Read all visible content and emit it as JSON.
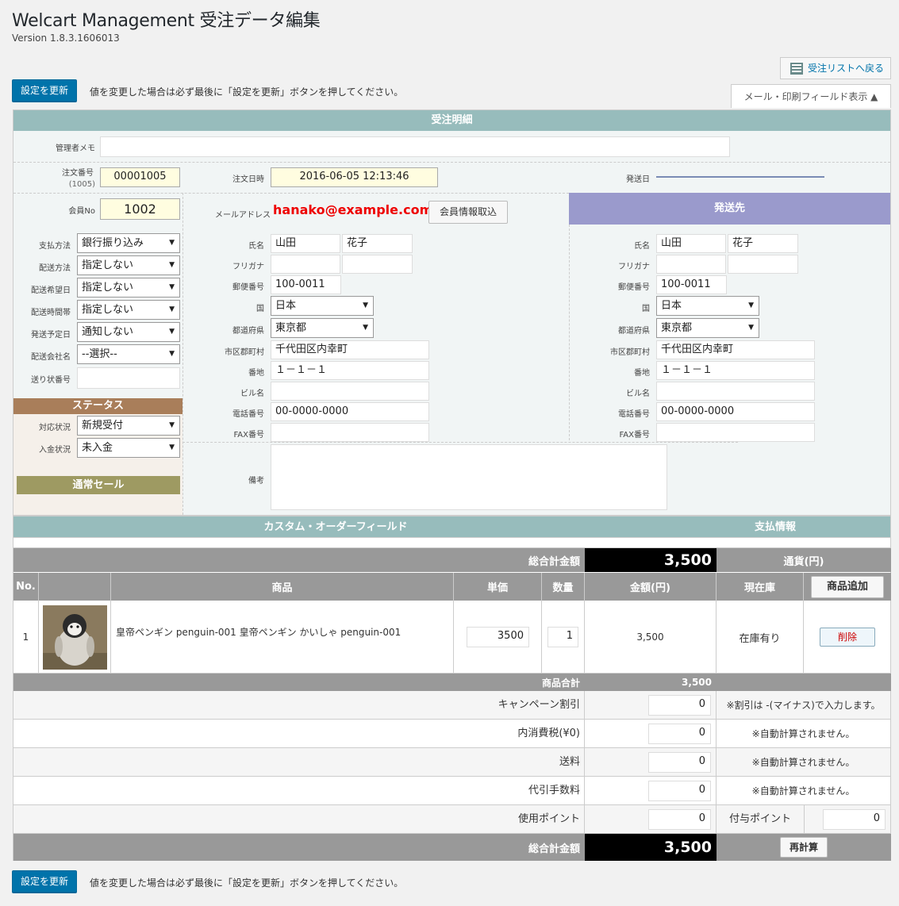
{
  "header": {
    "title": "Welcart Management 受注データ編集",
    "version": "Version 1.8.3.1606013",
    "back_label": "受注リストへ戻る",
    "mail_toggle": "メール・印刷フィールド表示 ▲"
  },
  "actions": {
    "update_label": "設定を更新",
    "update_note": "値を変更した場合は必ず最後に「設定を更新」ボタンを押してください。"
  },
  "order": {
    "section_title": "受注明細",
    "admin_memo_label": "管理者メモ",
    "order_no_label": "注文番号",
    "order_no_sub": "(1005)",
    "order_no": "00001005",
    "order_date_label": "注文日時",
    "order_date": "2016-06-05 12:13:46",
    "ship_date_label": "発送日",
    "member_no_label": "会員No",
    "member_no": "1002",
    "email_label": "メールアドレス",
    "email": "hanako@example.com",
    "fetch_member_label": "会員情報取込",
    "payment_label": "支払方法",
    "payment": "銀行振り込み",
    "delivery_method_label": "配送方法",
    "delivery_method": "指定しない",
    "delivery_date_label": "配送希望日",
    "delivery_date": "指定しない",
    "delivery_time_label": "配送時間帯",
    "delivery_time": "指定しない",
    "ship_plan_label": "発送予定日",
    "ship_plan": "通知しない",
    "carrier_label": "配送会社名",
    "carrier": "--選択--",
    "tracking_label": "送り状番号",
    "status_title": "ステータス",
    "response_label": "対応状況",
    "response": "新規受付",
    "payment_status_label": "入金状況",
    "payment_status": "未入金",
    "sale_title": "通常セール",
    "note_label": "備考"
  },
  "customer": {
    "name_label": "氏名",
    "last": "山田",
    "first": "花子",
    "kana_label": "フリガナ",
    "zip_label": "郵便番号",
    "zip": "100-0011",
    "country_label": "国",
    "country": "日本",
    "pref_label": "都道府県",
    "pref": "東京都",
    "city_label": "市区郡町村",
    "city": "千代田区内幸町",
    "addr_label": "番地",
    "addr": "１－１－１",
    "building_label": "ビル名",
    "tel_label": "電話番号",
    "tel": "00-0000-0000",
    "fax_label": "FAX番号"
  },
  "delivery": {
    "title": "発送先",
    "name_label": "氏名",
    "last": "山田",
    "first": "花子",
    "kana_label": "フリガナ",
    "zip_label": "郵便番号",
    "zip": "100-0011",
    "country_label": "国",
    "country": "日本",
    "pref_label": "都道府県",
    "pref": "東京都",
    "city_label": "市区郡町村",
    "city": "千代田区内幸町",
    "addr_label": "番地",
    "addr": "１－１－１",
    "building_label": "ビル名",
    "tel_label": "電話番号",
    "tel": "00-0000-0000",
    "fax_label": "FAX番号"
  },
  "custom": {
    "title": "カスタム・オーダーフィールド",
    "payinfo_title": "支払情報"
  },
  "cart": {
    "total_label": "総合計金額",
    "total": "3,500",
    "currency": "通貨(円)",
    "col_no": "No.",
    "col_item": "商品",
    "col_price": "単価",
    "col_qty": "数量",
    "col_amount": "金額(円)",
    "col_stock": "現在庫",
    "add_item": "商品追加",
    "items": [
      {
        "no": "1",
        "name": "皇帝ペンギン penguin-001 皇帝ペンギン かいしゃ penguin-001",
        "price": "3500",
        "qty": "1",
        "amount": "3,500",
        "stock": "在庫有り",
        "delete": "削除"
      }
    ],
    "subtotal_label": "商品合計",
    "subtotal": "3,500",
    "campaign_label": "キャンペーン割引",
    "campaign": "0",
    "campaign_note": "※割引は -(マイナス)で入力します。",
    "tax_label": "内消費税(¥0)",
    "tax": "0",
    "tax_note": "※自動計算されません。",
    "shipping_label": "送料",
    "shipping": "0",
    "shipping_note": "※自動計算されません。",
    "cod_label": "代引手数料",
    "cod": "0",
    "cod_note": "※自動計算されません。",
    "points_label": "使用ポイント",
    "points": "0",
    "grant_label": "付与ポイント",
    "grant": "0",
    "recalc": "再計算"
  }
}
